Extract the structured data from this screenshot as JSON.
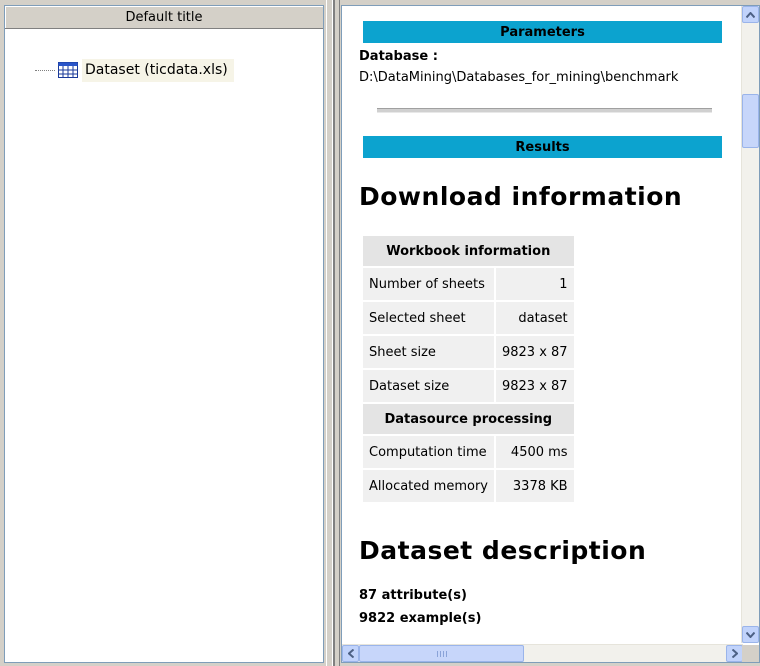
{
  "left_panel": {
    "title": "Default title",
    "tree": {
      "node_label": "Dataset (ticdata.xls)",
      "icon": "table-icon"
    }
  },
  "right_panel": {
    "parameters": {
      "header": "Parameters",
      "database_label": "Database :",
      "database_value": "D:\\DataMining\\Databases_for_mining\\benchmark"
    },
    "results": {
      "header": "Results",
      "download_heading": "Download information",
      "workbook": {
        "header": "Workbook information",
        "rows": [
          {
            "label": "Number of sheets",
            "value": "1"
          },
          {
            "label": "Selected sheet",
            "value": "dataset"
          },
          {
            "label": "Sheet size",
            "value": "9823 x 87"
          },
          {
            "label": "Dataset size",
            "value": "9823 x 87"
          }
        ]
      },
      "datasource": {
        "header": "Datasource processing",
        "rows": [
          {
            "label": "Computation time",
            "value": "4500 ms"
          },
          {
            "label": "Allocated memory",
            "value": "3378 KB"
          }
        ]
      },
      "description_heading": "Dataset description",
      "attributes": "87 attribute(s)",
      "examples": "9822 example(s)"
    }
  },
  "scrollbars": {
    "vertical_position": 0.12,
    "horizontal_position": 0.0,
    "icons": [
      "up-arrow-icon",
      "down-arrow-icon",
      "left-arrow-icon",
      "right-arrow-icon"
    ]
  },
  "colors": {
    "section_bar": "#0ca3cf",
    "tree_selection": "#f6f4e7"
  }
}
